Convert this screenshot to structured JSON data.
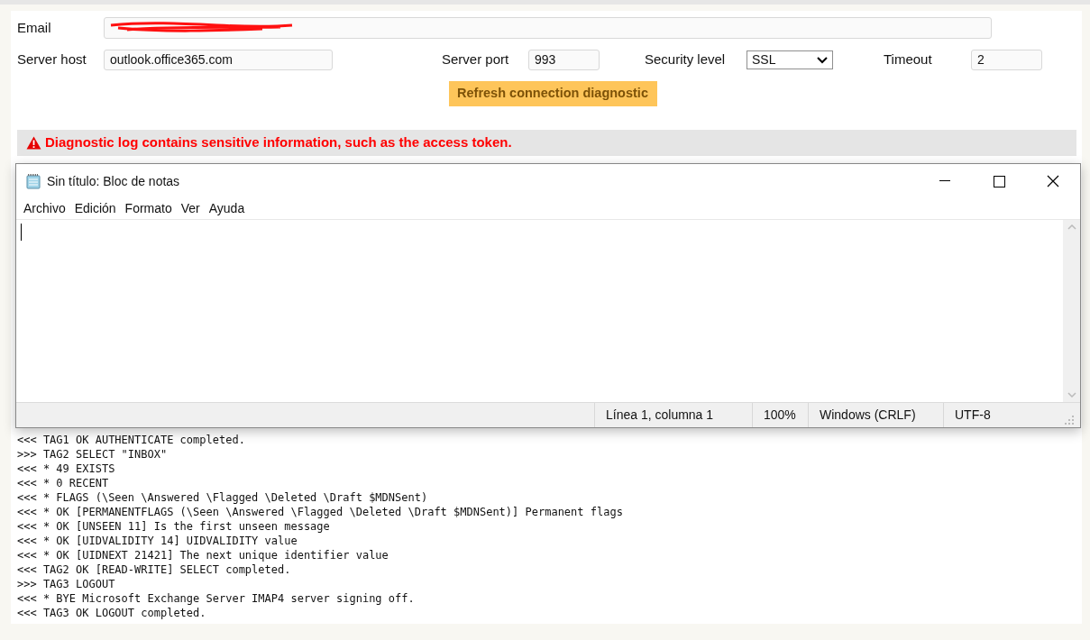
{
  "form": {
    "email": {
      "label": "Email",
      "redacted": true
    },
    "fields": [
      {
        "label": "Server host",
        "kind": "text",
        "value": "outlook.office365.com"
      },
      {
        "label": "Server port",
        "kind": "text",
        "value": "993"
      },
      {
        "label": "Security level",
        "kind": "select",
        "value": "SSL"
      },
      {
        "label": "Timeout",
        "kind": "text",
        "value": "2"
      }
    ],
    "button": "Refresh connection diagnostic"
  },
  "warning": "Diagnostic log contains sensitive information, such as the access token.",
  "log": [
    "<<< TAG1 OK AUTHENTICATE completed.",
    ">>> TAG2 SELECT \"INBOX\"",
    "<<< * 49 EXISTS",
    "<<< * 0 RECENT",
    "<<< * FLAGS (\\Seen \\Answered \\Flagged \\Deleted \\Draft $MDNSent)",
    "<<< * OK [PERMANENTFLAGS (\\Seen \\Answered \\Flagged \\Deleted \\Draft $MDNSent)] Permanent flags",
    "<<< * OK [UNSEEN 11] Is the first unseen message",
    "<<< * OK [UIDVALIDITY 14] UIDVALIDITY value",
    "<<< * OK [UIDNEXT 21421] The next unique identifier value",
    "<<< TAG2 OK [READ-WRITE] SELECT completed.",
    ">>> TAG3 LOGOUT",
    "<<< * BYE Microsoft Exchange Server IMAP4 server signing off.",
    "<<< TAG3 OK LOGOUT completed."
  ],
  "notepad": {
    "title": "Sin título: Bloc de notas",
    "menu": [
      "Archivo",
      "Edición",
      "Formato",
      "Ver",
      "Ayuda"
    ],
    "status_bar": [
      "Línea 1, columna 1",
      "100%",
      "Windows (CRLF)",
      "UTF-8"
    ]
  }
}
